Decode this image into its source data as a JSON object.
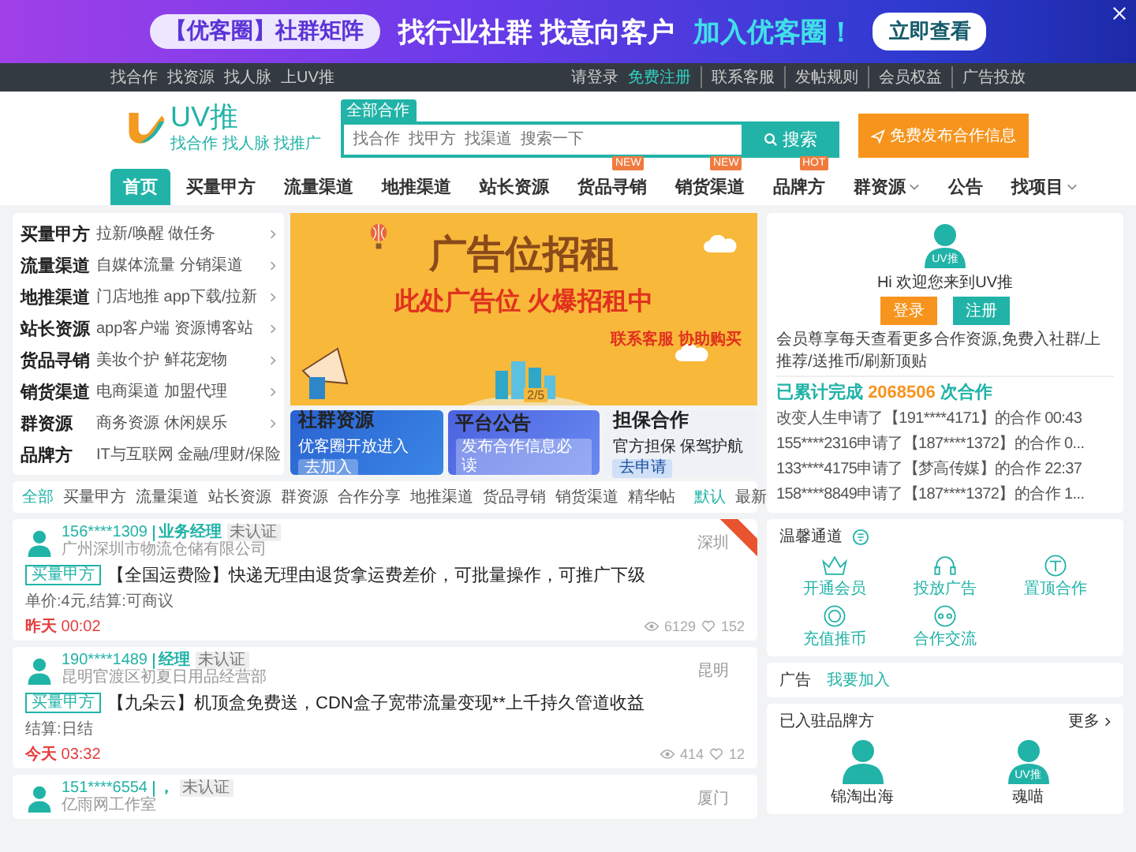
{
  "top_ad": {
    "tag": "【优客圈】社群矩阵",
    "headline": "找行业社群 找意向客户",
    "highlight": "加入优客圈！",
    "button": "立即查看"
  },
  "top_bar": {
    "links": [
      "找合作",
      "找资源",
      "找人脉",
      "上UV推"
    ],
    "login": "请登录",
    "register": "免费注册",
    "right_links": [
      "联系客服",
      "发帖规则",
      "会员权益",
      "广告投放"
    ]
  },
  "header": {
    "logo_text": "UV推",
    "logo_tagline": "找合作 找人脉 找推广",
    "search": {
      "tab": "全部合作",
      "placeholder": "找合作  找甲方  找渠道  搜索一下",
      "button": "搜索"
    },
    "publish_button": "免费发布合作信息"
  },
  "nav": [
    {
      "label": "首页",
      "selected": true,
      "dropdown": false
    },
    {
      "label": "买量甲方",
      "selected": false,
      "dropdown": false
    },
    {
      "label": "流量渠道",
      "selected": false,
      "dropdown": false
    },
    {
      "label": "地推渠道",
      "selected": false,
      "dropdown": false
    },
    {
      "label": "站长资源",
      "selected": false,
      "dropdown": false
    },
    {
      "label": "货品寻销",
      "selected": false,
      "dropdown": false,
      "badge": "NEW"
    },
    {
      "label": "销货渠道",
      "selected": false,
      "dropdown": false,
      "badge": "NEW"
    },
    {
      "label": "品牌方",
      "selected": false,
      "dropdown": false,
      "badge": "HOT"
    },
    {
      "label": "群资源",
      "selected": false,
      "dropdown": true
    },
    {
      "label": "公告",
      "selected": false,
      "dropdown": false
    },
    {
      "label": "找项目",
      "selected": false,
      "dropdown": true
    }
  ],
  "category_menu": [
    {
      "title": "买量甲方",
      "subtitle": "拉新/唤醒 做任务"
    },
    {
      "title": "流量渠道",
      "subtitle": "自媒体流量 分销渠道"
    },
    {
      "title": "地推渠道",
      "subtitle": "门店地推 app下载/拉新"
    },
    {
      "title": "站长资源",
      "subtitle": "app客户端 资源博客站"
    },
    {
      "title": "货品寻销",
      "subtitle": "美妆个护 鲜花宠物"
    },
    {
      "title": "销货渠道",
      "subtitle": "电商渠道 加盟代理"
    },
    {
      "title": "群资源",
      "subtitle": "商务资源 休闲娱乐"
    },
    {
      "title": "品牌方",
      "subtitle": "IT与互联网 金融/理财/保险"
    }
  ],
  "banner": {
    "title": "广告位招租",
    "subtitle": "此处广告位 火爆招租中",
    "contact": "联系客服 协助购买",
    "pager": "2/5"
  },
  "promos": [
    {
      "title": "社群资源",
      "subtitle": "优客圈开放进入",
      "button": "去加入",
      "kind": "blue"
    },
    {
      "title": "平台公告",
      "button": "发布合作信息必读",
      "kind": "violet"
    },
    {
      "title": "担保合作",
      "subtitle": "官方担保 保驾护航",
      "button": "去申请",
      "kind": "light"
    }
  ],
  "welcome": {
    "avatar_label": "UV推",
    "greeting": "Hi 欢迎您来到UV推",
    "buttons": [
      {
        "label": "登录",
        "kind": "login"
      },
      {
        "label": "注册",
        "kind": "register"
      }
    ],
    "perks": "会员尊享每天查看更多合作资源,免费入社群/上推荐/送推币/刷新顶贴",
    "stats_prefix": "已累计完成",
    "stats_count": "2068506",
    "stats_suffix": "次合作",
    "activity": [
      "改变人生申请了【191****4171】的合作 00:43",
      "155****2316申请了【187****1372】的合作 0...",
      "133****4175申请了【梦高传媒】的合作 22:37",
      "158****8849申请了【187****1372】的合作 1..."
    ]
  },
  "feed": {
    "tabs": [
      {
        "label": "全部",
        "selected": true
      },
      {
        "label": "买量甲方",
        "selected": false
      },
      {
        "label": "流量渠道",
        "selected": false
      },
      {
        "label": "站长资源",
        "selected": false
      },
      {
        "label": "群资源",
        "selected": false
      },
      {
        "label": "合作分享",
        "selected": false
      },
      {
        "label": "地推渠道",
        "selected": false
      },
      {
        "label": "货品寻销",
        "selected": false
      },
      {
        "label": "销货渠道",
        "selected": false
      },
      {
        "label": "精华帖",
        "selected": false
      }
    ],
    "sort": [
      {
        "label": "默认",
        "selected": true
      },
      {
        "label": "最新",
        "selected": false
      }
    ],
    "posts": [
      {
        "user": "156****1309",
        "role": "业务经理",
        "verify": "未认证",
        "company": "广州深圳市物流仓储有限公司",
        "city": "深圳",
        "pinned": true,
        "tag": "买量甲方",
        "title": "【全国运费险】快递无理由退货拿运费差价，可批量操作，可推广下级",
        "detail": "单价:4元,结算:可商议",
        "day": "昨天",
        "time": "00:02",
        "views": "6129",
        "likes": "152"
      },
      {
        "user": "190****1489",
        "role": "经理",
        "verify": "未认证",
        "company": "昆明官渡区初夏日用品经营部",
        "city": "昆明",
        "pinned": false,
        "tag": "买量甲方",
        "title": "【九朵云】机顶盒免费送，CDN盒子宽带流量变现**上千持久管道收益",
        "detail": "结算:日结",
        "day": "今天",
        "time": "03:32",
        "views": "414",
        "likes": "12"
      },
      {
        "user": "151****6554",
        "role": "，",
        "verify": "未认证",
        "company": "亿雨网工作室",
        "city": "厦门",
        "pinned": false
      }
    ]
  },
  "quick": {
    "title": "温馨通道",
    "items": [
      {
        "label": "开通会员",
        "kind": "crown"
      },
      {
        "label": "投放广告",
        "kind": "headset"
      },
      {
        "label": "置顶合作",
        "kind": "top"
      },
      {
        "label": "充值推币",
        "kind": "coin"
      },
      {
        "label": "合作交流",
        "kind": "chat"
      }
    ]
  },
  "ad_slot": {
    "title": "广告",
    "link": "我要加入"
  },
  "brands": {
    "title": "已入驻品牌方",
    "more": "更多",
    "items": [
      {
        "name": "锦淘出海"
      },
      {
        "name": "魂喵",
        "avatar_label": "UV推"
      }
    ]
  }
}
